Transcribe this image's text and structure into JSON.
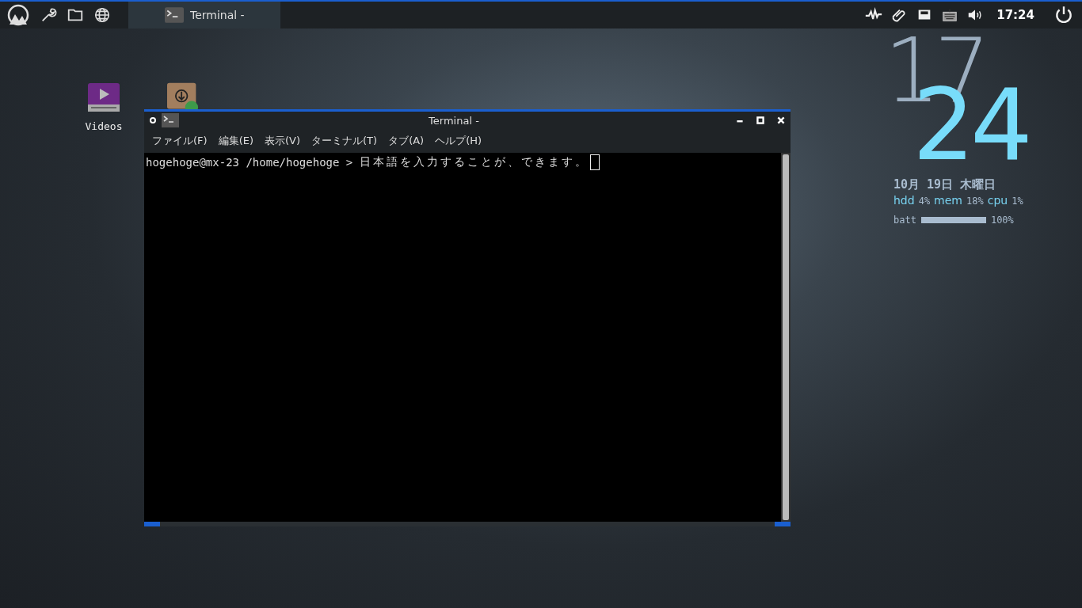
{
  "panel": {
    "taskbar": [
      {
        "label": "Terminal -",
        "selected": true
      }
    ],
    "clock": "17:24"
  },
  "desktop_icons": [
    {
      "kind": "video",
      "label": "Videos"
    },
    {
      "kind": "package"
    }
  ],
  "window": {
    "title": "Terminal -",
    "menu": [
      "ファイル(F)",
      "編集(E)",
      "表示(V)",
      "ターミナル(T)",
      "タブ(A)",
      "ヘルプ(H)"
    ],
    "prompt": "hogehoge@mx-23 /home/hogehoge >",
    "input": "日本語を入力することが、できます。"
  },
  "conky": {
    "hour": "17",
    "minute": "24",
    "date": "10月 19日 木曜日",
    "stats": [
      {
        "label": "hdd",
        "value": "4%"
      },
      {
        "label": "mem",
        "value": "18%"
      },
      {
        "label": "cpu",
        "value": "1%"
      }
    ],
    "battery": {
      "label": "batt",
      "level": 1.0,
      "reading": "100%"
    }
  }
}
